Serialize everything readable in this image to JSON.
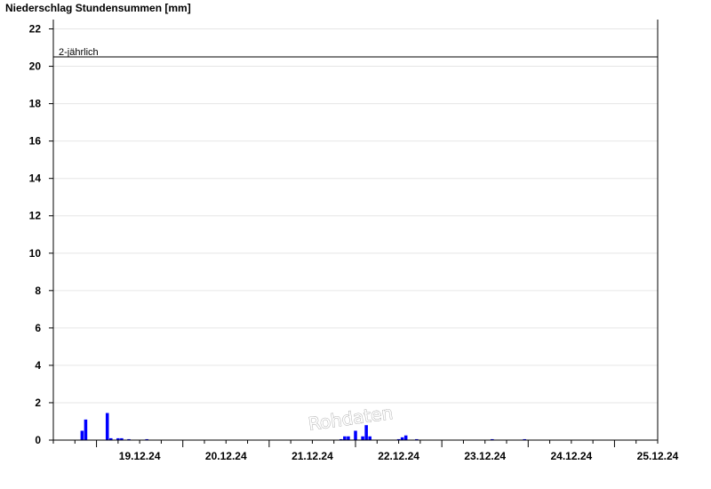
{
  "chart_data": {
    "type": "bar",
    "title": "Niederschlag Stundensummen [mm]",
    "xlabel": "",
    "ylabel": "",
    "ylim": [
      0,
      22.5
    ],
    "yticks": [
      0,
      2,
      4,
      6,
      8,
      10,
      12,
      14,
      16,
      18,
      20,
      22
    ],
    "x_start": "18.12.24 12:00",
    "x_end": "25.12.24 12:00",
    "x_tick_labels": [
      "19.12.24",
      "20.12.24",
      "21.12.24",
      "22.12.24",
      "23.12.24",
      "24.12.24",
      "25.12.24"
    ],
    "grid": true,
    "bar_color": "#0000ff",
    "threshold": {
      "label": "2-jährlich",
      "value": 20.5
    },
    "watermark": "Rohdaten",
    "bars": [
      {
        "t": "18.12.24 20:00",
        "v": 0.5
      },
      {
        "t": "18.12.24 21:00",
        "v": 1.1
      },
      {
        "t": "19.12.24 03:00",
        "v": 1.45
      },
      {
        "t": "19.12.24 04:00",
        "v": 0.1
      },
      {
        "t": "19.12.24 06:00",
        "v": 0.1
      },
      {
        "t": "19.12.24 07:00",
        "v": 0.1
      },
      {
        "t": "19.12.24 09:00",
        "v": 0.05
      },
      {
        "t": "19.12.24 14:00",
        "v": 0.05
      },
      {
        "t": "21.12.24 20:00",
        "v": 0.05
      },
      {
        "t": "21.12.24 21:00",
        "v": 0.2
      },
      {
        "t": "21.12.24 22:00",
        "v": 0.2
      },
      {
        "t": "22.12.24 00:00",
        "v": 0.5
      },
      {
        "t": "22.12.24 02:00",
        "v": 0.2
      },
      {
        "t": "22.12.24 03:00",
        "v": 0.8
      },
      {
        "t": "22.12.24 04:00",
        "v": 0.2
      },
      {
        "t": "22.12.24 12:00",
        "v": 0.05
      },
      {
        "t": "22.12.24 13:00",
        "v": 0.15
      },
      {
        "t": "22.12.24 14:00",
        "v": 0.25
      },
      {
        "t": "22.12.24 17:00",
        "v": 0.05
      },
      {
        "t": "23.12.24 14:00",
        "v": 0.05
      },
      {
        "t": "23.12.24 23:00",
        "v": 0.05
      }
    ]
  }
}
